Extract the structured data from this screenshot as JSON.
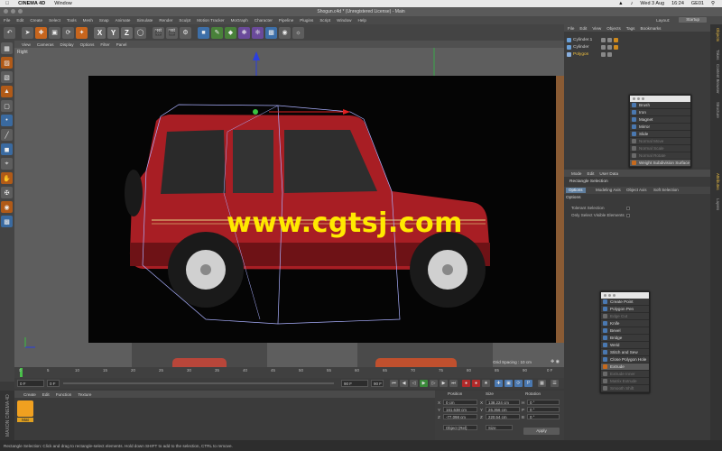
{
  "mac": {
    "app_name": "CINEMA 4D",
    "menu": [
      "Window"
    ],
    "date": "Wed 3 Aug",
    "time": "16:24",
    "user": "GE01"
  },
  "window": {
    "title": "Shogun.c4d * (Unregistered License) - Main"
  },
  "app_menu": [
    "File",
    "Edit",
    "Create",
    "Select",
    "Tools",
    "Mesh",
    "Snap",
    "Animate",
    "Simulate",
    "Render",
    "Sculpt",
    "Motion Tracker",
    "MoGraph",
    "Character",
    "Pipeline",
    "Plugins",
    "Script",
    "Window",
    "Help"
  ],
  "layout": {
    "label": "Layout:",
    "value": "Startup"
  },
  "toolbar": {
    "axis_x": "X",
    "axis_y": "Y",
    "axis_z": "Z"
  },
  "viewport": {
    "menu": [
      "View",
      "Cameras",
      "Display",
      "Options",
      "Filter",
      "Panel"
    ],
    "label": "Right",
    "grid_spacing": "Grid Spacing : 10 cm",
    "watermark": "www.cgtsj.com"
  },
  "timeline": {
    "ticks": [
      "0",
      "5",
      "10",
      "15",
      "20",
      "25",
      "30",
      "35",
      "40",
      "45",
      "50",
      "55",
      "60",
      "65",
      "70",
      "75",
      "80",
      "85",
      "90"
    ],
    "frame_end": "0 F",
    "start_field": "0 F",
    "min_field": "0 F",
    "end_field": "90 F",
    "max_field": "90 F"
  },
  "material_manager": {
    "menu": [
      "Create",
      "Edit",
      "Function",
      "Texture"
    ],
    "material_name": "Mat",
    "brand": "MAXON CINEMA 4D"
  },
  "coordinates": {
    "headers": {
      "position": "Position",
      "size": "Size",
      "rotation": "Rotation"
    },
    "rows": [
      {
        "axis": "X",
        "pos": "0 cm",
        "size_axis": "X",
        "size": "138.224 cm",
        "rot_axis": "H",
        "rot": "0 °"
      },
      {
        "axis": "Y",
        "pos": "161.638 cm",
        "size_axis": "Y",
        "size": "26.356 cm",
        "rot_axis": "P",
        "rot": "0 °"
      },
      {
        "axis": "Z",
        "pos": "-77.098 cm",
        "size_axis": "Z",
        "size": "220.54 cm",
        "rot_axis": "B",
        "rot": "0 °"
      }
    ],
    "mode": "Object (Rel)",
    "size_mode": "Size",
    "apply_label": "Apply"
  },
  "status": {
    "text": "Rectangle Selection: Click and drag to rectangle-select elements. Hold down SHIFT to add to the selection, CTRL to remove."
  },
  "object_manager": {
    "menu": [
      "File",
      "Edit",
      "View",
      "Objects",
      "Tags",
      "Bookmarks"
    ],
    "objects": [
      {
        "name": "Cylinder.1"
      },
      {
        "name": "Cylinder"
      },
      {
        "name": "Polygon"
      }
    ]
  },
  "right_tabs": [
    "Objects",
    "Takes",
    "Content Browser",
    "Structure",
    "Attributes",
    "Layers"
  ],
  "attribute_manager": {
    "menu": [
      "Mode",
      "Edit",
      "User Data"
    ],
    "title": "Rectangle Selection",
    "tabs": [
      "Options",
      "Modeling Axis",
      "Object Axis",
      "Soft Selection"
    ],
    "section": "Options",
    "options": [
      {
        "label": "Tolerant Selection"
      },
      {
        "label": "Only Select Visible Elements"
      }
    ]
  },
  "palette_deform": {
    "items": [
      {
        "label": "Brush",
        "dim": false
      },
      {
        "label": "Iron",
        "dim": false
      },
      {
        "label": "Magnet",
        "dim": false
      },
      {
        "label": "Mirror",
        "dim": false
      },
      {
        "label": "Slide",
        "dim": false
      },
      {
        "label": "Normal Move",
        "dim": true
      },
      {
        "label": "Normal Scale",
        "dim": true
      },
      {
        "label": "Normal Rotate",
        "dim": true
      },
      {
        "label": "Weight Subdivision Surface",
        "dim": false
      }
    ]
  },
  "palette_mesh": {
    "items": [
      {
        "label": "Create Point",
        "dim": false
      },
      {
        "label": "Polygon Pen",
        "dim": false
      },
      {
        "label": "Edge Cut",
        "dim": true
      },
      {
        "label": "Knife",
        "dim": false
      },
      {
        "label": "Bevel",
        "dim": false
      },
      {
        "label": "Bridge",
        "dim": false
      },
      {
        "label": "Weld",
        "dim": false
      },
      {
        "label": "Stitch and Sew",
        "dim": false
      },
      {
        "label": "Close Polygon Hole",
        "dim": false
      },
      {
        "label": "Extrude",
        "dim": false
      },
      {
        "label": "Extrude Inner",
        "dim": true
      },
      {
        "label": "Matrix Extrude",
        "dim": true
      },
      {
        "label": "Smooth Shift",
        "dim": true
      }
    ]
  },
  "colors": {
    "accent": "#5f7e9e",
    "watermark": "#ffe900",
    "material": "#f0a020",
    "car_body": "#a81e24"
  }
}
